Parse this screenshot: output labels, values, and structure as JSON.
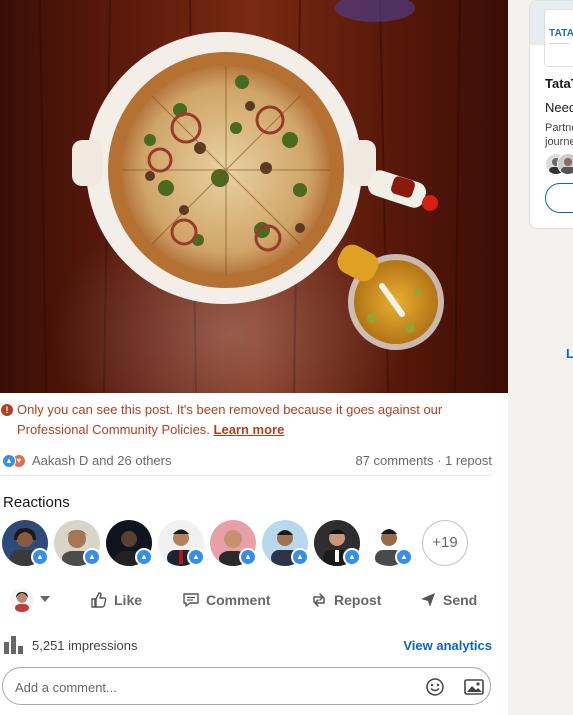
{
  "post": {
    "image_alt": "Pizza on a white plate with a drink and a hot sauce bottle on a wooden table",
    "notice": {
      "text": "Only you can see this post. It's been removed because it goes against our Professional Community Policies.",
      "link_label": "Learn more",
      "icon": "warning-icon"
    },
    "social": {
      "likers": "Aakash D and 26 others",
      "counts": "87 comments · 1 repost"
    },
    "reactions": {
      "title": "Reactions",
      "more": "+19"
    },
    "actions": {
      "like": "Like",
      "comment": "Comment",
      "repost": "Repost",
      "send": "Send"
    },
    "impressions": {
      "text": "5,251 impressions",
      "link": "View analytics"
    },
    "comment": {
      "placeholder": "Add a comment..."
    }
  },
  "sidebar_ad": {
    "logo_text": "TATA",
    "name": "TataT",
    "headline": "Need",
    "body_line1": "Partne",
    "body_line2": "journe",
    "side_link": "L"
  },
  "colors": {
    "notice": "#b24020",
    "link": "#0a66c2",
    "like": "#378fe9"
  }
}
